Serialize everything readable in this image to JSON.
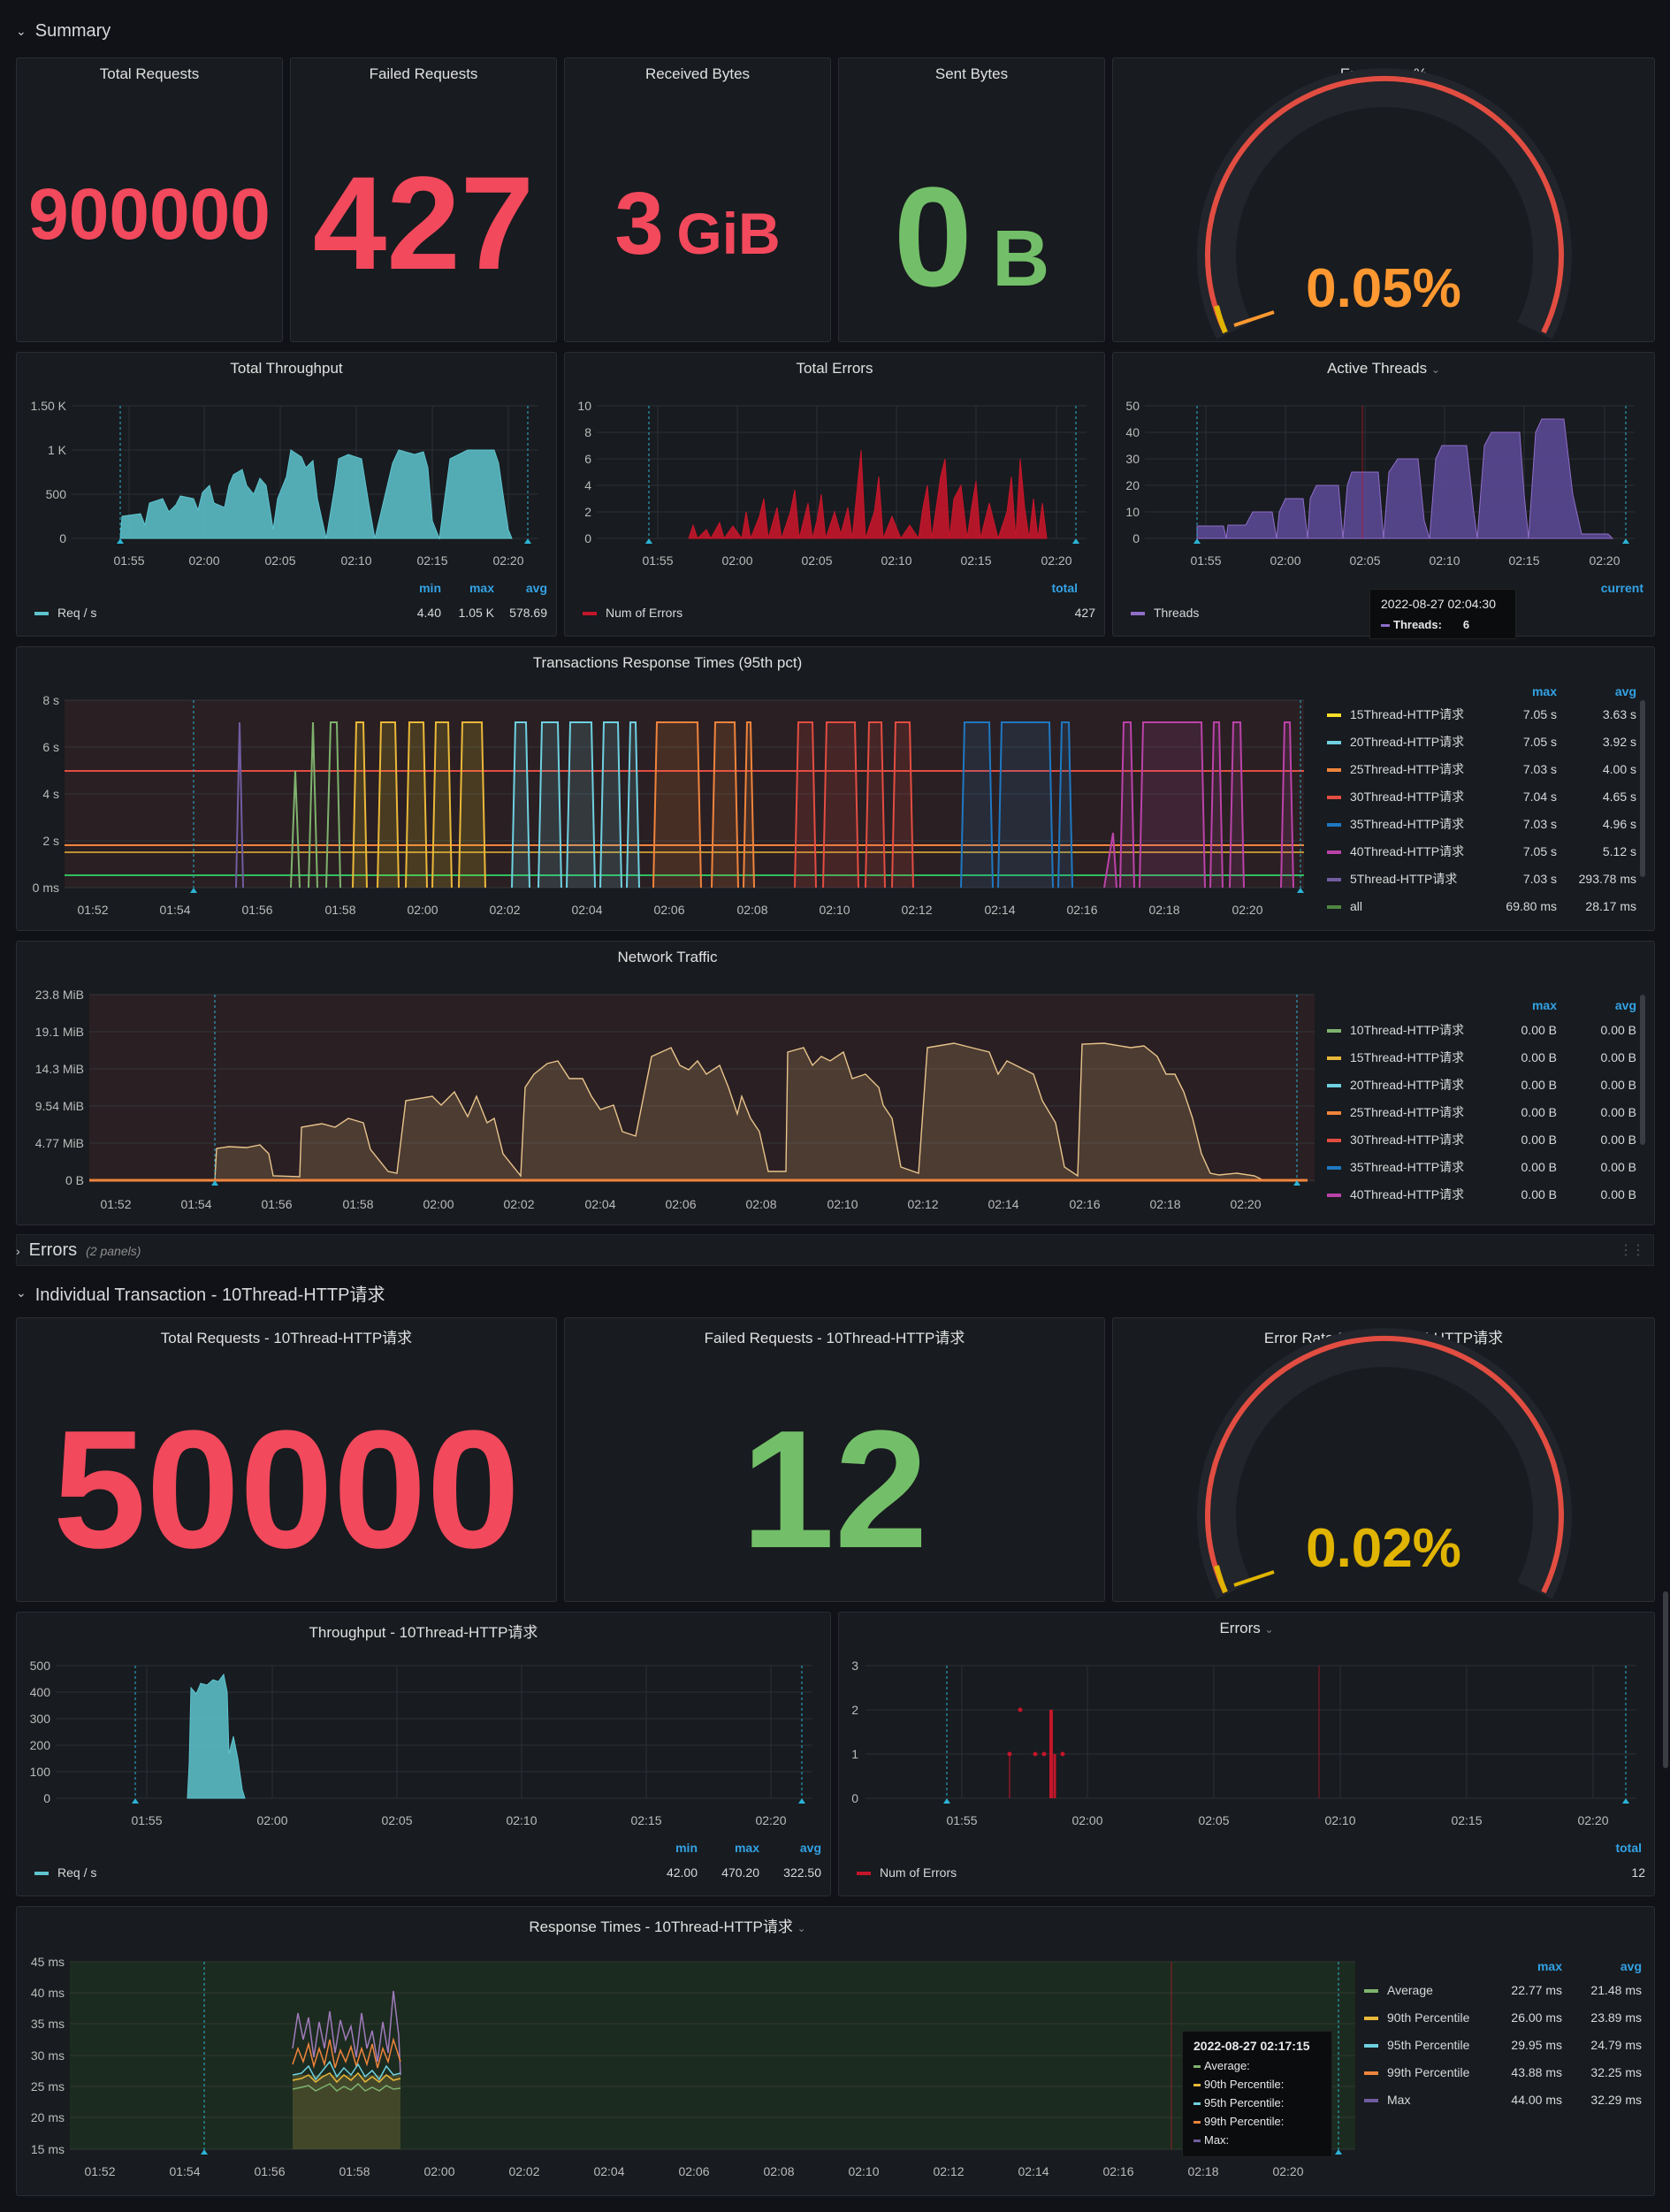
{
  "summary_row": {
    "title": "Summary"
  },
  "errors_row": {
    "title": "Errors",
    "subtitle": "(2 panels)"
  },
  "individual_row": {
    "title": "Individual Transaction - 10Thread-HTTP请求"
  },
  "stats": {
    "total_requests": {
      "title": "Total Requests",
      "value": "900000",
      "color": "#f2495c"
    },
    "failed_requests": {
      "title": "Failed Requests",
      "value": "427",
      "color": "#f2495c"
    },
    "received_bytes": {
      "title": "Received Bytes",
      "value": "3",
      "unit": "GiB",
      "color": "#f2495c"
    },
    "sent_bytes": {
      "title": "Sent Bytes",
      "value": "0",
      "unit": "B",
      "color": "#73bf69"
    },
    "error_rate": {
      "title": "Error Rate %",
      "value": "0.05%",
      "fraction": 0.0005,
      "color": "#ff9830"
    }
  },
  "total_throughput": {
    "title": "Total Throughput",
    "yticks": [
      "1.50 K",
      "1 K",
      "500",
      "0"
    ],
    "xticks": [
      "01:55",
      "02:00",
      "02:05",
      "02:10",
      "02:15",
      "02:20"
    ],
    "legend_headers": [
      "min",
      "max",
      "avg"
    ],
    "series_name": "Req / s",
    "series_color": "#5ec4cf",
    "values": [
      "4.40",
      "1.05 K",
      "578.69"
    ]
  },
  "total_errors": {
    "title": "Total Errors",
    "yticks": [
      "10",
      "8",
      "6",
      "4",
      "2",
      "0"
    ],
    "xticks": [
      "01:55",
      "02:00",
      "02:05",
      "02:10",
      "02:15",
      "02:20"
    ],
    "legend_header": "total",
    "series_name": "Num of Errors",
    "series_color": "#c4162a",
    "value": "427"
  },
  "active_threads": {
    "title": "Active Threads",
    "yticks": [
      "50",
      "40",
      "30",
      "20",
      "10",
      "0"
    ],
    "xticks": [
      "01:55",
      "02:00",
      "02:05",
      "02:10",
      "02:15",
      "02:20"
    ],
    "legend_header": "current",
    "series_name": "Threads",
    "series_color": "#8f6fc9",
    "tooltip": {
      "time": "2022-08-27 02:04:30",
      "label": "Threads:",
      "value": "6"
    }
  },
  "response_times": {
    "title": "Transactions Response Times (95th pct)",
    "yticks": [
      "8 s",
      "6 s",
      "4 s",
      "2 s",
      "0 ms"
    ],
    "xticks": [
      "01:52",
      "01:54",
      "01:56",
      "01:58",
      "02:00",
      "02:02",
      "02:04",
      "02:06",
      "02:08",
      "02:10",
      "02:12",
      "02:14",
      "02:16",
      "02:18",
      "02:20"
    ],
    "headers": [
      "max",
      "avg"
    ],
    "rows": [
      {
        "name": "15Thread-HTTP请求",
        "color": "#fade2a",
        "max": "7.05 s",
        "avg": "3.63 s"
      },
      {
        "name": "20Thread-HTTP请求",
        "color": "#6ed0e0",
        "max": "7.05 s",
        "avg": "3.92 s"
      },
      {
        "name": "25Thread-HTTP请求",
        "color": "#ef843c",
        "max": "7.03 s",
        "avg": "4.00 s"
      },
      {
        "name": "30Thread-HTTP请求",
        "color": "#e24d42",
        "max": "7.04 s",
        "avg": "4.65 s"
      },
      {
        "name": "35Thread-HTTP请求",
        "color": "#1f78c1",
        "max": "7.03 s",
        "avg": "4.96 s"
      },
      {
        "name": "40Thread-HTTP请求",
        "color": "#ba43a9",
        "max": "7.05 s",
        "avg": "5.12 s"
      },
      {
        "name": "5Thread-HTTP请求",
        "color": "#705da0",
        "max": "7.03 s",
        "avg": "293.78 ms"
      },
      {
        "name": "all",
        "color": "#508642",
        "max": "69.80 ms",
        "avg": "28.17 ms"
      }
    ]
  },
  "network": {
    "title": "Network Traffic",
    "yticks": [
      "23.8 MiB",
      "19.1 MiB",
      "14.3 MiB",
      "9.54 MiB",
      "4.77 MiB",
      "0 B"
    ],
    "xticks": [
      "01:52",
      "01:54",
      "01:56",
      "01:58",
      "02:00",
      "02:02",
      "02:04",
      "02:06",
      "02:08",
      "02:10",
      "02:12",
      "02:14",
      "02:16",
      "02:18",
      "02:20"
    ],
    "headers": [
      "max",
      "avg"
    ],
    "rows": [
      {
        "name": "10Thread-HTTP请求",
        "color": "#7eb26d",
        "max": "0.00 B",
        "avg": "0.00 B"
      },
      {
        "name": "15Thread-HTTP请求",
        "color": "#eab839",
        "max": "0.00 B",
        "avg": "0.00 B"
      },
      {
        "name": "20Thread-HTTP请求",
        "color": "#6ed0e0",
        "max": "0.00 B",
        "avg": "0.00 B"
      },
      {
        "name": "25Thread-HTTP请求",
        "color": "#ef843c",
        "max": "0.00 B",
        "avg": "0.00 B"
      },
      {
        "name": "30Thread-HTTP请求",
        "color": "#e24d42",
        "max": "0.00 B",
        "avg": "0.00 B"
      },
      {
        "name": "35Thread-HTTP请求",
        "color": "#1f78c1",
        "max": "0.00 B",
        "avg": "0.00 B"
      },
      {
        "name": "40Thread-HTTP请求",
        "color": "#ba43a9",
        "max": "0.00 B",
        "avg": "0.00 B"
      }
    ]
  },
  "indiv_stats": {
    "total_requests": {
      "title": "Total Requests - 10Thread-HTTP请求",
      "value": "50000",
      "color": "#f2495c"
    },
    "failed_requests": {
      "title": "Failed Requests - 10Thread-HTTP请求",
      "value": "12",
      "color": "#73bf69"
    },
    "error_rate": {
      "title": "Error Rate % - 10Thread-HTTP请求",
      "value": "0.02%",
      "fraction": 0.0002,
      "color": "#e0b400"
    }
  },
  "indiv_throughput": {
    "title": "Throughput - 10Thread-HTTP请求",
    "yticks": [
      "500",
      "400",
      "300",
      "200",
      "100",
      "0"
    ],
    "xticks": [
      "01:55",
      "02:00",
      "02:05",
      "02:10",
      "02:15",
      "02:20"
    ],
    "legend_headers": [
      "min",
      "max",
      "avg"
    ],
    "series_name": "Req / s",
    "series_color": "#5ec4cf",
    "values": [
      "42.00",
      "470.20",
      "322.50"
    ]
  },
  "indiv_errors": {
    "title": "Errors",
    "yticks": [
      "3",
      "2",
      "1",
      "0"
    ],
    "xticks": [
      "01:55",
      "02:00",
      "02:05",
      "02:10",
      "02:15",
      "02:20"
    ],
    "legend_header": "total",
    "series_name": "Num of Errors",
    "series_color": "#c4162a",
    "value": "12"
  },
  "indiv_response": {
    "title": "Response Times - 10Thread-HTTP请求",
    "yticks": [
      "45 ms",
      "40 ms",
      "35 ms",
      "30 ms",
      "25 ms",
      "20 ms",
      "15 ms"
    ],
    "xticks": [
      "01:52",
      "01:54",
      "01:56",
      "01:58",
      "02:00",
      "02:02",
      "02:04",
      "02:06",
      "02:08",
      "02:10",
      "02:12",
      "02:14",
      "02:16",
      "02:18",
      "02:20"
    ],
    "headers": [
      "max",
      "avg"
    ],
    "rows": [
      {
        "name": "Average",
        "color": "#7eb26d",
        "max": "22.77 ms",
        "avg": "21.48 ms"
      },
      {
        "name": "90th Percentile",
        "color": "#eab839",
        "max": "26.00 ms",
        "avg": "23.89 ms"
      },
      {
        "name": "95th Percentile",
        "color": "#6ed0e0",
        "max": "29.95 ms",
        "avg": "24.79 ms"
      },
      {
        "name": "99th Percentile",
        "color": "#ef843c",
        "max": "43.88 ms",
        "avg": "32.25 ms"
      },
      {
        "name": "Max",
        "color": "#705da0",
        "max": "44.00 ms",
        "avg": "32.29 ms"
      }
    ],
    "tooltip": {
      "time": "2022-08-27 02:17:15",
      "items": [
        "Average:",
        "90th Percentile:",
        "95th Percentile:",
        "99th Percentile:",
        "Max:"
      ]
    }
  }
}
